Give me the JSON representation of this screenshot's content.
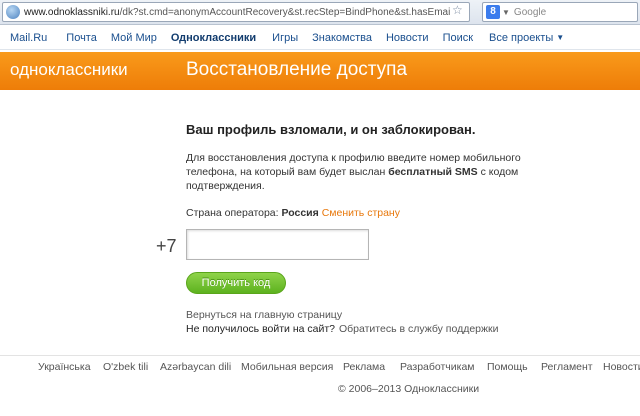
{
  "browser": {
    "url_domain": "www.odnoklassniki.ru",
    "url_rest": "/dk?st.cmd=anonymAccountRecovery&st.recStep=BindPhone&st.hasEmai",
    "search_placeholder": "Google",
    "search_engine_letter": "8"
  },
  "portal_nav": {
    "items": [
      "Mail.Ru",
      "Почта",
      "Мой Мир",
      "Одноклассники",
      "Игры",
      "Знакомства",
      "Новости",
      "Поиск",
      "Все проекты"
    ],
    "active_index": 3
  },
  "banner": {
    "logo": "одноклассники",
    "title": "Восстановление доступа",
    "color": "#f3890f"
  },
  "main": {
    "heading": "Ваш профиль взломали, и он заблокирован.",
    "desc_part1": "Для восстановления доступа к профилю введите номер мобильного телефона, на который вам будет выслан ",
    "desc_bold": "бесплатный SMS",
    "desc_part2": " с кодом подтверждения.",
    "country_label": "Страна оператора: ",
    "country_value": "Россия",
    "change_country": "Сменить страну",
    "phone_prefix": "+7",
    "phone_value": "",
    "submit_label": "Получить код",
    "back_link": "Вернуться на главную страницу",
    "help_text": "Не получилось войти на сайт?",
    "help_link": "Обратитесь в службу поддержки"
  },
  "footer": {
    "links": [
      "Українська",
      "O'zbek tili",
      "Azərbaycan dili",
      "Мобильная версия",
      "Реклама",
      "Разработчикам",
      "Помощь",
      "Регламент",
      "Новости"
    ],
    "copyright": "© 2006–2013 Одноклассники"
  },
  "colors": {
    "accent": "#f3890f",
    "link_orange": "#e8780c",
    "button_green": "#6cbf2a",
    "nav_blue": "#1a4f8e"
  }
}
